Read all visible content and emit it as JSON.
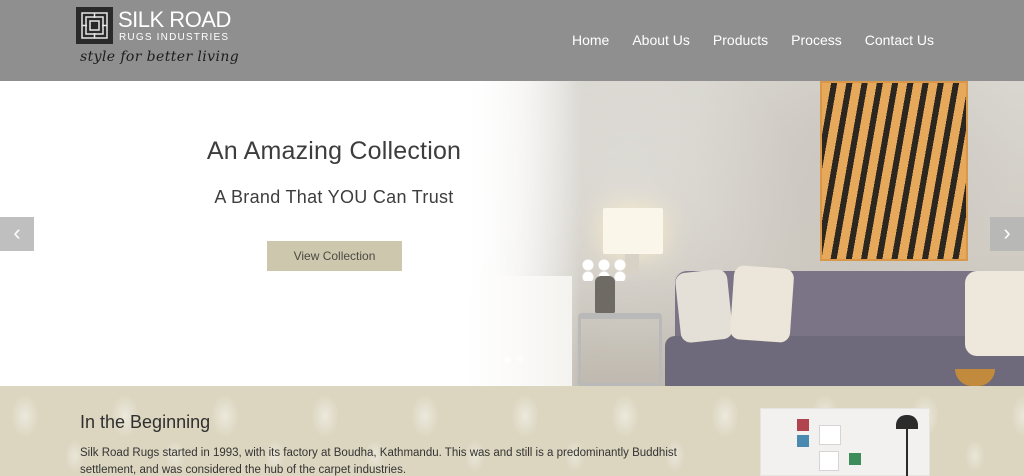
{
  "brand": {
    "name": "SILK ROAD",
    "subtitle": "RUGS INDUSTRIES",
    "tagline": "style for better living"
  },
  "nav": {
    "items": [
      {
        "label": "Home"
      },
      {
        "label": "About Us"
      },
      {
        "label": "Products"
      },
      {
        "label": "Process"
      },
      {
        "label": "Contact Us"
      }
    ]
  },
  "hero": {
    "title": "An Amazing Collection",
    "subtitle": "A Brand That YOU Can Trust",
    "button_label": "View Collection",
    "prev_icon": "chevron-left-icon",
    "next_icon": "chevron-right-icon",
    "prev_glyph": "‹",
    "next_glyph": "›",
    "slide_count": 2,
    "active_slide": 2
  },
  "about": {
    "title": "In the Beginning",
    "body": "Silk Road Rugs started in 1993, with its factory at Boudha, Kathmandu. This was and still is a predominantly Buddhist settlement, and was considered the hub of the carpet industries."
  },
  "colors": {
    "header_bg": "#8f8f8f",
    "button_bg": "#cdc7ad",
    "section_bg": "#dcd6c0"
  }
}
